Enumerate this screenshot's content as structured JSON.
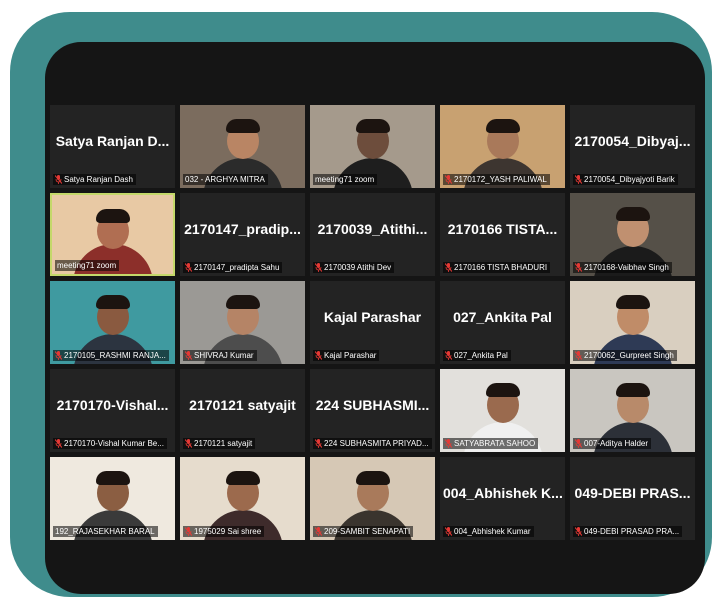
{
  "participants": [
    {
      "display": "Satya Ranjan D...",
      "label": "Satya Ranjan Dash",
      "muted": true,
      "video": false
    },
    {
      "display": "",
      "label": "032 - ARGHYA MITRA",
      "muted": false,
      "video": true,
      "bg": "#7b6c5e",
      "skin": "#b98564",
      "shirt": "#2b2b2b"
    },
    {
      "display": "",
      "label": "meeting71 zoom",
      "muted": false,
      "video": true,
      "bg": "#a59a8c",
      "skin": "#6d4d3c",
      "shirt": "#1e1e1e"
    },
    {
      "display": "",
      "label": "2170172_YASH PALIWAL",
      "muted": true,
      "video": true,
      "bg": "#c8a171",
      "skin": "#a9795a",
      "shirt": "#3d3530"
    },
    {
      "display": "2170054_Dibyaj...",
      "label": "2170054_Dibyajyoti Barik",
      "muted": true,
      "video": false
    },
    {
      "display": "",
      "label": "meeting71 zoom",
      "muted": false,
      "video": true,
      "active": true,
      "bg": "#e8c9a4",
      "skin": "#b06e52",
      "shirt": "#8c2f2a"
    },
    {
      "display": "2170147_pradip...",
      "label": "2170147_pradipta Sahu",
      "muted": true,
      "video": false
    },
    {
      "display": "2170039_Atithi...",
      "label": "2170039 Atithi Dev",
      "muted": true,
      "video": false
    },
    {
      "display": "2170166 TISTA...",
      "label": "2170166 TISTA BHADURI",
      "muted": true,
      "video": false
    },
    {
      "display": "",
      "label": "2170168-Vaibhav Singh",
      "muted": true,
      "video": true,
      "bg": "#555048",
      "skin": "#c09070",
      "shirt": "#1b1b1b"
    },
    {
      "display": "",
      "label": "2170105_RASHMI RANJA...",
      "muted": true,
      "video": true,
      "bg": "#3f9aa0",
      "skin": "#8a5a40",
      "shirt": "#2c3440"
    },
    {
      "display": "",
      "label": "SHIVRAJ Kumar",
      "muted": true,
      "video": true,
      "bg": "#9b9995",
      "skin": "#b58466",
      "shirt": "#4d4d4d"
    },
    {
      "display": "Kajal Parashar",
      "label": "Kajal Parashar",
      "muted": true,
      "video": false
    },
    {
      "display": "027_Ankita Pal",
      "label": "027_Ankita Pal",
      "muted": true,
      "video": false
    },
    {
      "display": "",
      "label": "2170062_Gurpreet Singh",
      "muted": true,
      "video": true,
      "bg": "#d9cfc0",
      "skin": "#c08c68",
      "shirt": "#2e3a55"
    },
    {
      "display": "2170170-Vishal...",
      "label": "2170170-Vishal Kumar Be...",
      "muted": true,
      "video": false
    },
    {
      "display": "2170121 satyajit",
      "label": "2170121 satyajit",
      "muted": true,
      "video": false
    },
    {
      "display": "224 SUBHASMI...",
      "label": "224 SUBHASMITA PRIYAD...",
      "muted": true,
      "video": false
    },
    {
      "display": "",
      "label": "SATYABRATA SAHOO",
      "muted": true,
      "video": true,
      "bg": "#e2e0dc",
      "skin": "#9a6a4e",
      "shirt": "#f0f0f0"
    },
    {
      "display": "",
      "label": "007-Aditya Halder",
      "muted": true,
      "video": true,
      "bg": "#c9c6c0",
      "skin": "#b88a6a",
      "shirt": "#2c3038"
    },
    {
      "display": "",
      "label": "192_RAJASEKHAR BARAL",
      "muted": false,
      "video": true,
      "bg": "#efe9df",
      "skin": "#8b5e42",
      "shirt": "#3a3a3a"
    },
    {
      "display": "",
      "label": "1975029 Sai shree",
      "muted": true,
      "video": true,
      "bg": "#e6dccd",
      "skin": "#9c6a4d",
      "shirt": "#3e2b2b"
    },
    {
      "display": "",
      "label": "209-SAMBIT SENAPATI",
      "muted": true,
      "video": true,
      "bg": "#d6c8b5",
      "skin": "#a97a5b",
      "shirt": "#3a342e"
    },
    {
      "display": "004_Abhishek K...",
      "label": "004_Abhishek Kumar",
      "muted": true,
      "video": false
    },
    {
      "display": "049-DEBI PRAS...",
      "label": "049-DEBI PRASAD PRA...",
      "muted": true,
      "video": false
    }
  ],
  "colors": {
    "frame": "#3f8c8c",
    "screen": "#151515",
    "tile": "#232323",
    "active_border": "#c4d86a",
    "muted_icon": "#e53935"
  }
}
